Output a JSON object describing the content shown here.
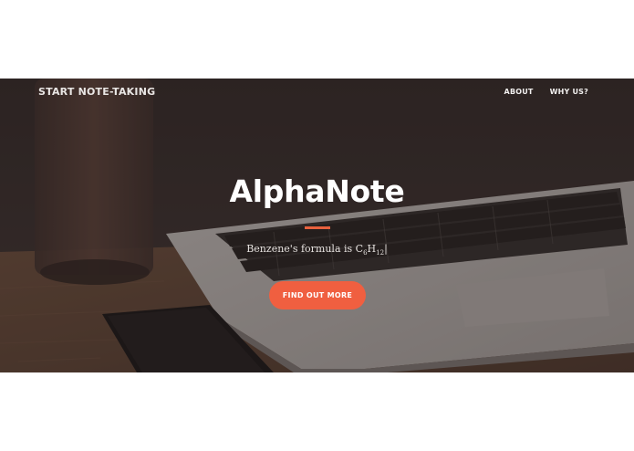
{
  "navbar": {
    "brand": "START NOTE-TAKING",
    "links": [
      {
        "label": "ABOUT"
      },
      {
        "label": "WHY US?"
      }
    ]
  },
  "hero": {
    "title": "AlphaNote",
    "subtitle_prefix": "Benzene's formula is C",
    "sub_6": "6",
    "subtitle_h": "H",
    "sub_12": "12",
    "cursor": "|",
    "cta_label": "FIND OUT MORE"
  },
  "colors": {
    "accent": "#f05f40",
    "divider": "#e8613e",
    "hero_overlay": "#2d2321"
  }
}
